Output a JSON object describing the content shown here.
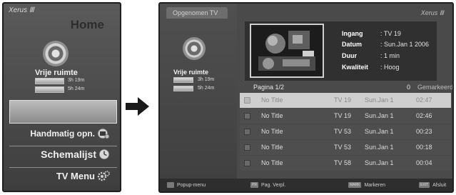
{
  "left_panel": {
    "logo_text": "Xerus Ⅲ",
    "title": "Home",
    "free_space_label": "Vrije ruimte",
    "bars": [
      {
        "time": "3h  19m"
      },
      {
        "time": "5h  24m"
      }
    ],
    "menu": [
      {
        "label": "Handmatig opn.",
        "icon": "record-icon"
      },
      {
        "label": "Schemalijst",
        "icon": "clock-icon"
      },
      {
        "label": "TV Menu",
        "icon": "gear-icon"
      }
    ]
  },
  "right_panel": {
    "tab_title": "Opgenomen TV",
    "logo_text": "Xerus Ⅲ",
    "free_space_label": "Vrije ruimte",
    "bars": [
      {
        "time": "3h  19m"
      },
      {
        "time": "5h  24m"
      }
    ],
    "info": {
      "ingang_key": "Ingang",
      "ingang_val": ": TV 19",
      "datum_key": "Datum",
      "datum_val": ": Sun.Jan 1 2006",
      "duur_key": "Duur",
      "duur_val": ": 1 min",
      "kwaliteit_key": "Kwaliteit",
      "kwaliteit_val": ": Hoog"
    },
    "page_label": "Pagina   1/2",
    "marked_count": "0",
    "marked_label": "Gemarkeerd",
    "rows": [
      {
        "title": "No Title",
        "channel": "TV 19",
        "date": "Sun.Jan 1",
        "time": "02:47",
        "selected": true
      },
      {
        "title": "No Title",
        "channel": "TV 19",
        "date": "Sun.Jan 1",
        "time": "02:46",
        "selected": false
      },
      {
        "title": "No Title",
        "channel": "TV 53",
        "date": "Sun.Jan 1",
        "time": "00:23",
        "selected": false
      },
      {
        "title": "No Title",
        "channel": "TV 53",
        "date": "Sun.Jan 1",
        "time": "00:18",
        "selected": false
      },
      {
        "title": "No Title",
        "channel": "TV 58",
        "date": "Sun.Jan 1",
        "time": "00:04",
        "selected": false
      }
    ],
    "footer": {
      "popup_label": "Popup-menu",
      "page_key": "PR",
      "page_label": "Pag. Verpl.",
      "mark_key": "MARK",
      "mark_label": "Markeren",
      "exit_key": "EXIT",
      "exit_label": "Afsluit"
    }
  },
  "colors": {
    "panel_bg": "#4a4a4a",
    "selected_row": "#cfcfcf",
    "border": "#1e1e1e"
  }
}
